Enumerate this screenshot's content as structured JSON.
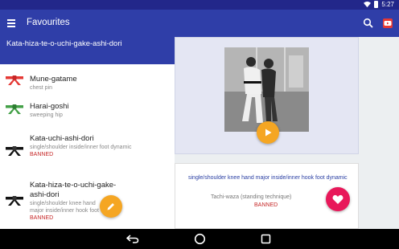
{
  "status_bar": {
    "time": "5:27"
  },
  "app_bar": {
    "title": "Favourites",
    "search_icon": "search-icon",
    "youtube_icon": "youtube-icon",
    "color": "#2f3ea8"
  },
  "selected": {
    "title": "Kata-hiza-te-o-uchi-gake-ashi-dori"
  },
  "list": [
    {
      "name": "Mune-gatame",
      "desc": "chest pin",
      "banned": "",
      "belt_color": "#e53935"
    },
    {
      "name": "Harai-goshi",
      "desc": "sweeping hip",
      "banned": "",
      "belt_color": "#43a047"
    },
    {
      "name": "Kata-uchi-ashi-dori",
      "desc": "single/shoulder inside/inner foot dynamic",
      "banned": "BANNED",
      "belt_color": "#111111"
    },
    {
      "name": "Kata-hiza-te-o-uchi-gake-ashi-dori",
      "desc": "single/shoulder knee hand major inside/inner hook foot",
      "banned": "BANNED",
      "belt_color": "#111111"
    }
  ],
  "detail": {
    "description": "single/shoulder knee hand major inside/inner hook foot dynamic",
    "category": "Tachi-waza (standing technique)",
    "banned": "BANNED"
  },
  "accent_color": "#f5a623",
  "favourite_color": "#e8185a",
  "banned_color": "#c62828"
}
